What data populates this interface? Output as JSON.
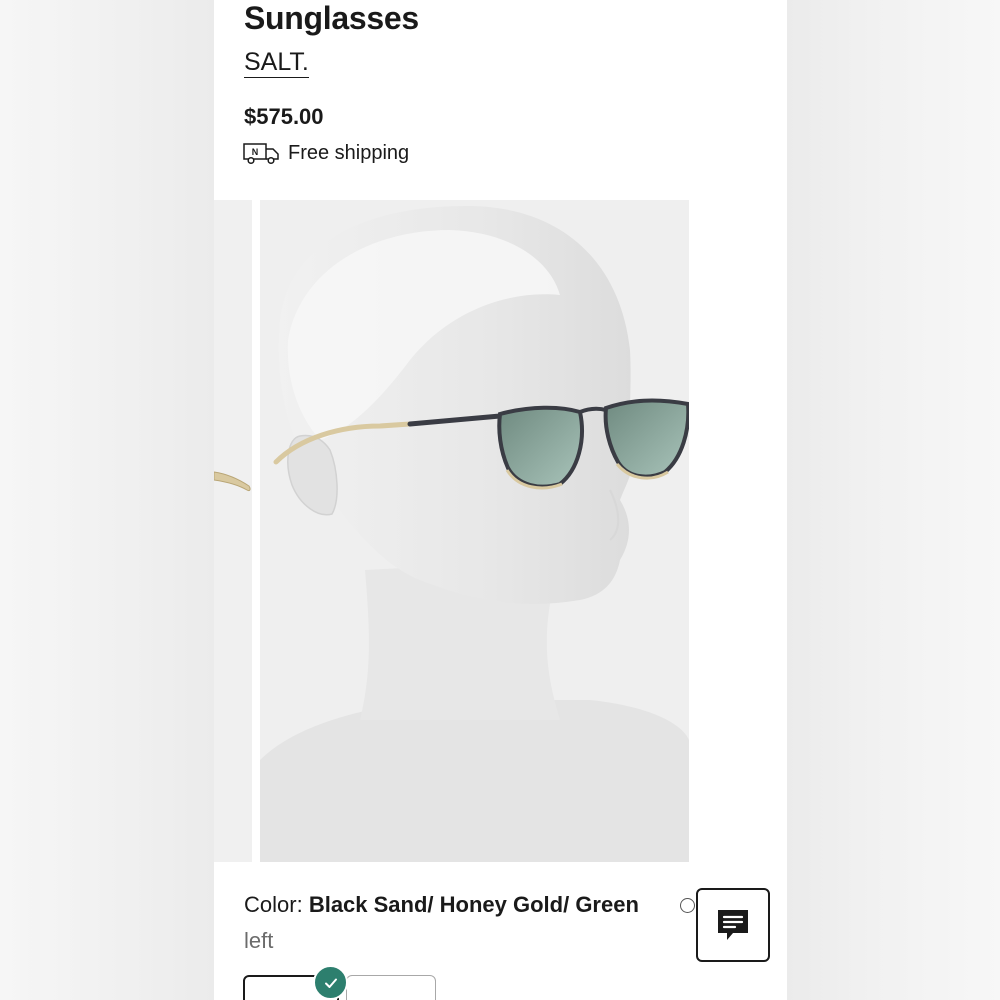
{
  "product": {
    "title": "Sunglasses",
    "brand": "SALT.",
    "price": "$575.00",
    "shipping_label": "Free shipping",
    "shipping_icon_text": "N",
    "shipping_icon": "delivery-truck-icon"
  },
  "gallery": {
    "slides": [
      "mannequin-side-view",
      "mannequin-front-view"
    ]
  },
  "color": {
    "label": "Color:",
    "value": "Black Sand/ Honey Gold/ Green",
    "value_continued": "left",
    "selected_index": 0
  },
  "chat": {
    "icon": "chat-icon"
  },
  "colors": {
    "text": "#1a1a1a",
    "muted": "#6b6b6b",
    "accent_check": "#2d7f6e",
    "frame_black": "#3a3c44",
    "frame_gold": "#d9c9a0",
    "lens_green": "#8aa59b"
  }
}
